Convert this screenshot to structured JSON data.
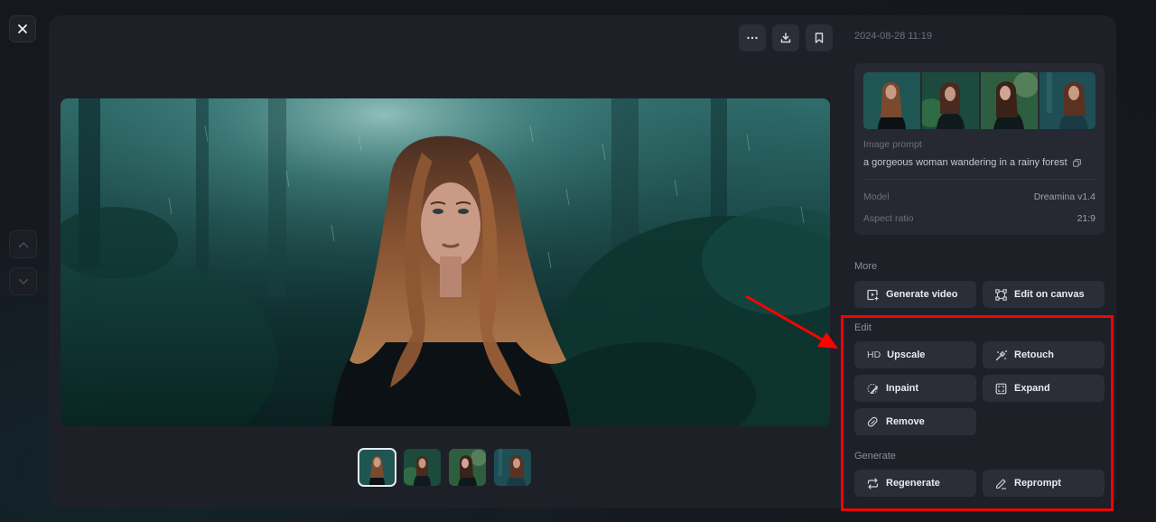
{
  "window": {
    "close_icon": "close-icon",
    "nav_up_icon": "chevron-up-icon",
    "nav_down_icon": "chevron-down-icon"
  },
  "toolbar": {
    "more_icon": "ellipsis-icon",
    "download_icon": "download-icon",
    "bookmark_icon": "bookmark-icon"
  },
  "viewer": {
    "thumbnails_count": 4,
    "selected_index": 0
  },
  "details": {
    "timestamp": "2024-08-28 11:19",
    "prompt_label": "Image prompt",
    "prompt_text": "a gorgeous woman wandering in a rainy forest",
    "model_label": "Model",
    "model_value": "Dreamina v1.4",
    "aspect_label": "Aspect ratio",
    "aspect_value": "21:9"
  },
  "sections": {
    "more": {
      "label": "More",
      "buttons": [
        {
          "label": "Generate video",
          "icon": "video-add-icon"
        },
        {
          "label": "Edit on canvas",
          "icon": "canvas-icon"
        }
      ]
    },
    "edit": {
      "label": "Edit",
      "buttons": [
        {
          "label": "Upscale",
          "icon_text": "HD"
        },
        {
          "label": "Retouch",
          "icon": "magic-wand-icon"
        },
        {
          "label": "Inpaint",
          "icon": "inpaint-brush-icon"
        },
        {
          "label": "Expand",
          "icon": "expand-icon"
        },
        {
          "label": "Remove",
          "icon": "eraser-icon"
        }
      ]
    },
    "generate": {
      "label": "Generate",
      "buttons": [
        {
          "label": "Regenerate",
          "icon": "repeat-icon"
        },
        {
          "label": "Reprompt",
          "icon": "pencil-icon"
        }
      ]
    }
  },
  "annotation": {
    "highlight_color": "#ff0000"
  }
}
